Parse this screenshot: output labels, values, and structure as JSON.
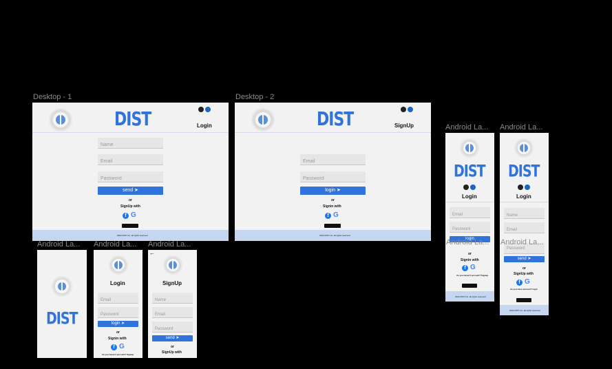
{
  "frames": {
    "desktop1": {
      "title": "Desktop - 1",
      "header_title": "Login"
    },
    "desktop2": {
      "title": "Desktop - 2",
      "header_title": "SignUp"
    },
    "android_a": {
      "title": "Android La..."
    },
    "android_b": {
      "title": "Android La..."
    },
    "android_c": {
      "title": "Android La..."
    },
    "android_d": {
      "title": "Android La..."
    },
    "android_e": {
      "title": "Android La..."
    },
    "android_f": {
      "title": "Android La..."
    },
    "android_g": {
      "title": "Android La..."
    }
  },
  "brand": {
    "logo_text": "DIST",
    "accent": "#2f73db",
    "footer_color": "#c5d6f0"
  },
  "form": {
    "name_placeholder": "Name",
    "email_placeholder": "Email",
    "password_placeholder": "Password",
    "send_label": "send",
    "login_label": "login",
    "or_text": "or",
    "signup_with": "SignUp with",
    "signin_with": "Signin with",
    "login_title": "Login",
    "signup_title": "SignUp"
  },
  "footer_text": "2022 DIST Inc. all rights reserved.",
  "links": {
    "no_account": "do you haven't account? Signup",
    "have_account": "do you have account? login"
  },
  "icons": {
    "github": "github-icon",
    "linkedin": "linkedin-icon",
    "facebook": "facebook-icon",
    "google": "google-icon",
    "googleplay": "google-play-badge",
    "send": "send-icon",
    "back": "back-arrow-icon"
  }
}
